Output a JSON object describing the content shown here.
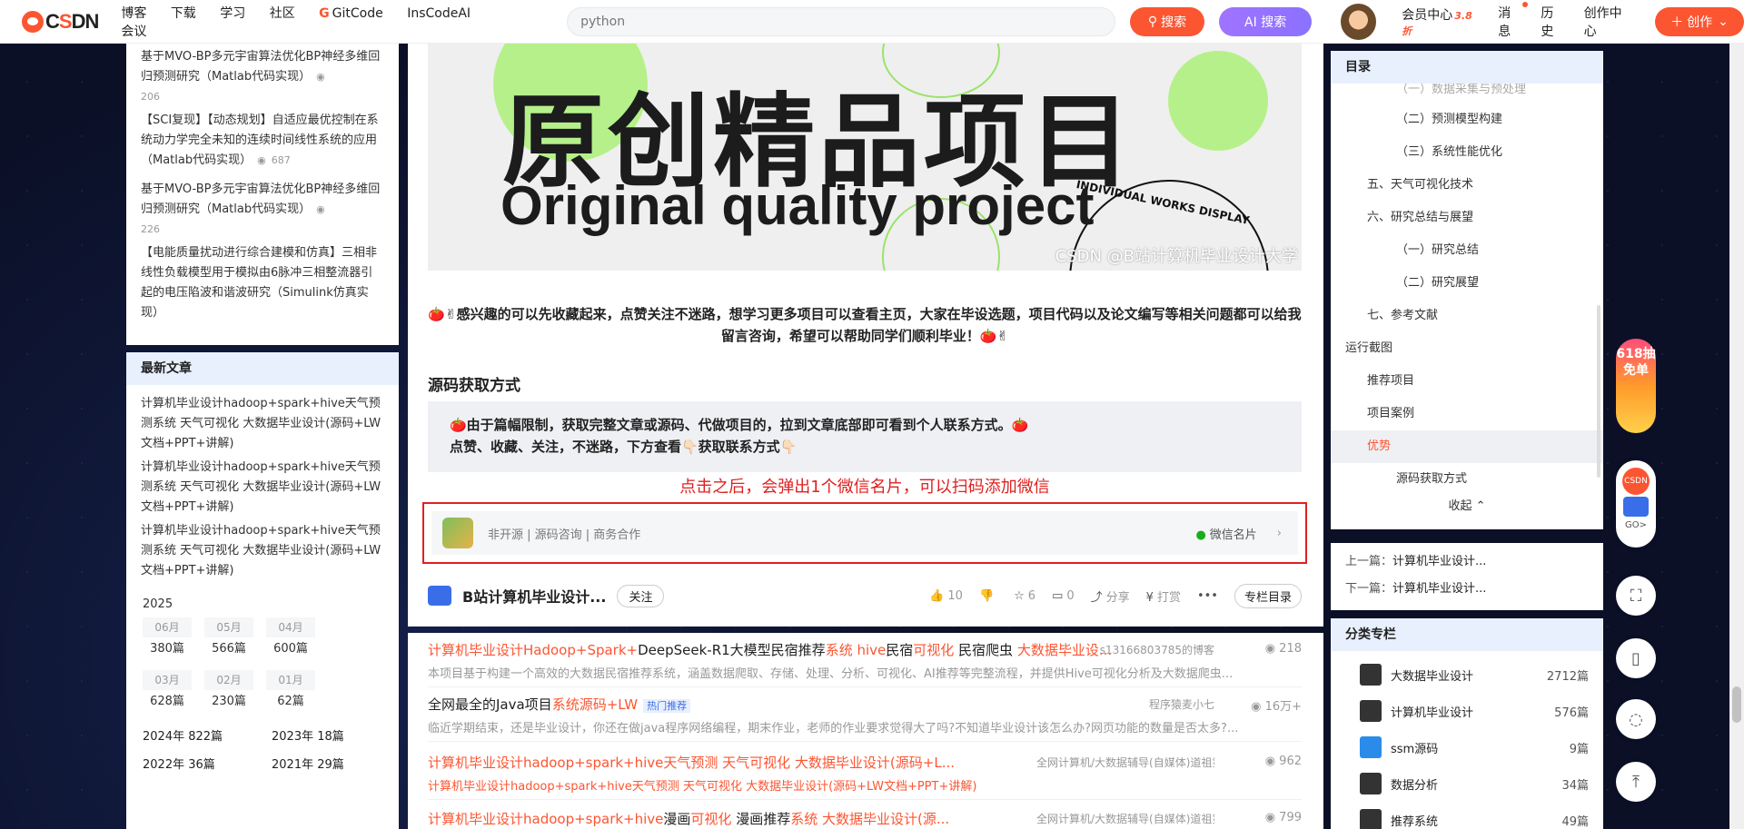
{
  "topbar": {
    "logo": "CSDN",
    "nav": [
      "博客",
      "下载",
      "学习",
      "社区",
      "GitCode",
      "InsCodeAI",
      "会议"
    ],
    "search_value": "python",
    "search_btn": "搜索",
    "ai_btn": "AI 搜索",
    "links": [
      "会员中心",
      "消息",
      "历史",
      "创作中心"
    ],
    "vip_badge": "3.8折",
    "create_btn": "创作"
  },
  "left": {
    "related": [
      {
        "title": "基于MVO-BP多元宇宙算法优化BP神经多维回归预测研究（Matlab代码实现）",
        "views": "206"
      },
      {
        "title": "【SCI复现】【动态规划】自适应最优控制在系统动力学完全未知的连续时间线性系统的应用（Matlab代码实现）",
        "views": "687"
      },
      {
        "title": "基于MVO-BP多元宇宙算法优化BP神经多维回归预测研究（Matlab代码实现）",
        "views": "226"
      },
      {
        "title": "【电能质量扰动进行综合建模和仿真】三相非线性负载模型用于模拟由6脉冲三相整流器引起的电压陷波和谐波研究（Simulink仿真实现）",
        "views": ""
      }
    ],
    "latest_title": "最新文章",
    "latest": [
      "计算机毕业设计hadoop+spark+hive天气预测系统 天气可视化 大数据毕业设计(源码+LW文档+PPT+讲解)",
      "计算机毕业设计hadoop+spark+hive天气预测系统 天气可视化 大数据毕业设计(源码+LW文档+PPT+讲解)",
      "计算机毕业设计hadoop+spark+hive天气预测系统 天气可视化 大数据毕业设计(源码+LW文档+PPT+讲解)"
    ],
    "year": "2025",
    "months": [
      {
        "m": "06月",
        "c": "380篇"
      },
      {
        "m": "05月",
        "c": "566篇"
      },
      {
        "m": "04月",
        "c": "600篇"
      },
      {
        "m": "03月",
        "c": "628篇"
      },
      {
        "m": "02月",
        "c": "230篇"
      },
      {
        "m": "01月",
        "c": "62篇"
      }
    ],
    "years": [
      {
        "y": "2024年",
        "c": "822篇"
      },
      {
        "y": "2023年",
        "c": "18篇"
      },
      {
        "y": "2022年",
        "c": "36篇"
      },
      {
        "y": "2021年",
        "c": "29篇"
      }
    ]
  },
  "article": {
    "banner_cn": "原创精品项目",
    "banner_en": "Original quality project",
    "banner_tag": "INDIVIDUAL WORKS DISPLAY",
    "watermark": "CSDN @B站计算机毕业设计大学",
    "intro": "🍅✌感兴趣的可以先收藏起来，点赞关注不迷路，想学习更多项目可以查看主页，大家在毕设选题，项目代码以及论文编写等相关问题都可以给我留言咨询，希望可以帮助同学们顺利毕业！🍅✌",
    "section": "源码获取方式",
    "quote1": "🍅由于篇幅限制，获取完整文章或源码、代做项目的，拉到文章底部即可看到个人联系方式。🍅",
    "quote2": "点赞、收藏、关注，不迷路，下方查看👇🏻获取联系方式👇🏻",
    "red_note": "点击之后，会弹出1个微信名片，可以扫码添加微信",
    "contact_text": "非开源 | 源码咨询 | 商务合作",
    "wechat": "微信名片",
    "author": "B站计算机毕业设计...",
    "follow": "关注",
    "likes": "10",
    "stars": "6",
    "comments": "0",
    "share": "分享",
    "reward": "打赏",
    "column": "专栏目录"
  },
  "recs": [
    {
      "title_parts": [
        "计算机毕业设计Hadoop+Spark+",
        "DeepSeek-R1大模型民宿推荐",
        "系统 hive",
        "民宿",
        "可视化",
        " 民宿爬虫 ",
        "大数据毕业设..."
      ],
      "src": "s13166803785的博客",
      "views": "218",
      "sub": "本项目基于构建一个高效的大数据民宿推荐系统，涵盖数据爬取、存储、处理、分析、可视化、AI推荐等完整流程，并提供Hive可视化分析及大数据爬虫..."
    },
    {
      "title_parts": [
        "全网最全的Java项目",
        "系统源码+LW"
      ],
      "hot": "热门推荐",
      "src": "程序猿麦小七",
      "views": "16万+",
      "sub": "临近学期结束，还是毕业设计，你还在做java程序网络编程，期末作业，老师的作业要求觉得大了吗?不知道毕业设计该怎么办?网页功能的数量是否太多?..."
    },
    {
      "title_parts": [
        "计算机毕业设计hadoop+spark+hive天气预测 天气可视化 大数据毕业设计(源码+L..."
      ],
      "src": "全网计算机/大数据辅导(自媒体)道祖第一人、全网粉...",
      "views": "962",
      "sub": "计算机毕业设计hadoop+spark+hive天气预测 天气可视化 大数据毕业设计(源码+LW文档+PPT+讲解)"
    },
    {
      "title_parts": [
        "计算机毕业设计hadoop+spark+hive",
        "漫画",
        "可视化",
        " 漫画推荐",
        "系统 大数据毕业设计(源..."
      ],
      "src": "全网计算机/大数据辅导(自媒体)道祖第一人、全网粉...",
      "views": "799",
      "sub": ""
    }
  ],
  "toc": {
    "title": "目录",
    "items": [
      {
        "t": "（一）数据采集与预处理",
        "lvl": 3
      },
      {
        "t": "（二）预测模型构建",
        "lvl": 3
      },
      {
        "t": "（三）系统性能优化",
        "lvl": 3
      },
      {
        "t": "五、天气可视化技术",
        "lvl": 2
      },
      {
        "t": "六、研究总结与展望",
        "lvl": 2
      },
      {
        "t": "（一）研究总结",
        "lvl": 3
      },
      {
        "t": "（二）研究展望",
        "lvl": 3
      },
      {
        "t": "七、参考文献",
        "lvl": 2
      },
      {
        "t": "运行截图",
        "lvl": 1
      },
      {
        "t": "推荐项目",
        "lvl": 2
      },
      {
        "t": "项目案例",
        "lvl": 2
      },
      {
        "t": "优势",
        "lvl": 2,
        "sel": true
      },
      {
        "t": "源码获取方式",
        "lvl": 3
      }
    ],
    "fold": "收起"
  },
  "prevnext": {
    "prev_label": "上一篇：",
    "prev": "计算机毕业设计...",
    "next_label": "下一篇：",
    "next": "计算机毕业设计..."
  },
  "category": {
    "title": "分类专栏",
    "rows": [
      {
        "name": "大数据毕业设计",
        "count": "2712篇"
      },
      {
        "name": "计算机毕业设计",
        "count": "576篇"
      },
      {
        "name": "ssm源码",
        "count": "9篇"
      },
      {
        "name": "数据分析",
        "count": "34篇"
      },
      {
        "name": "推荐系统",
        "count": "49篇"
      }
    ]
  },
  "float": {
    "promo": "618抽免单",
    "go": "GO>"
  }
}
